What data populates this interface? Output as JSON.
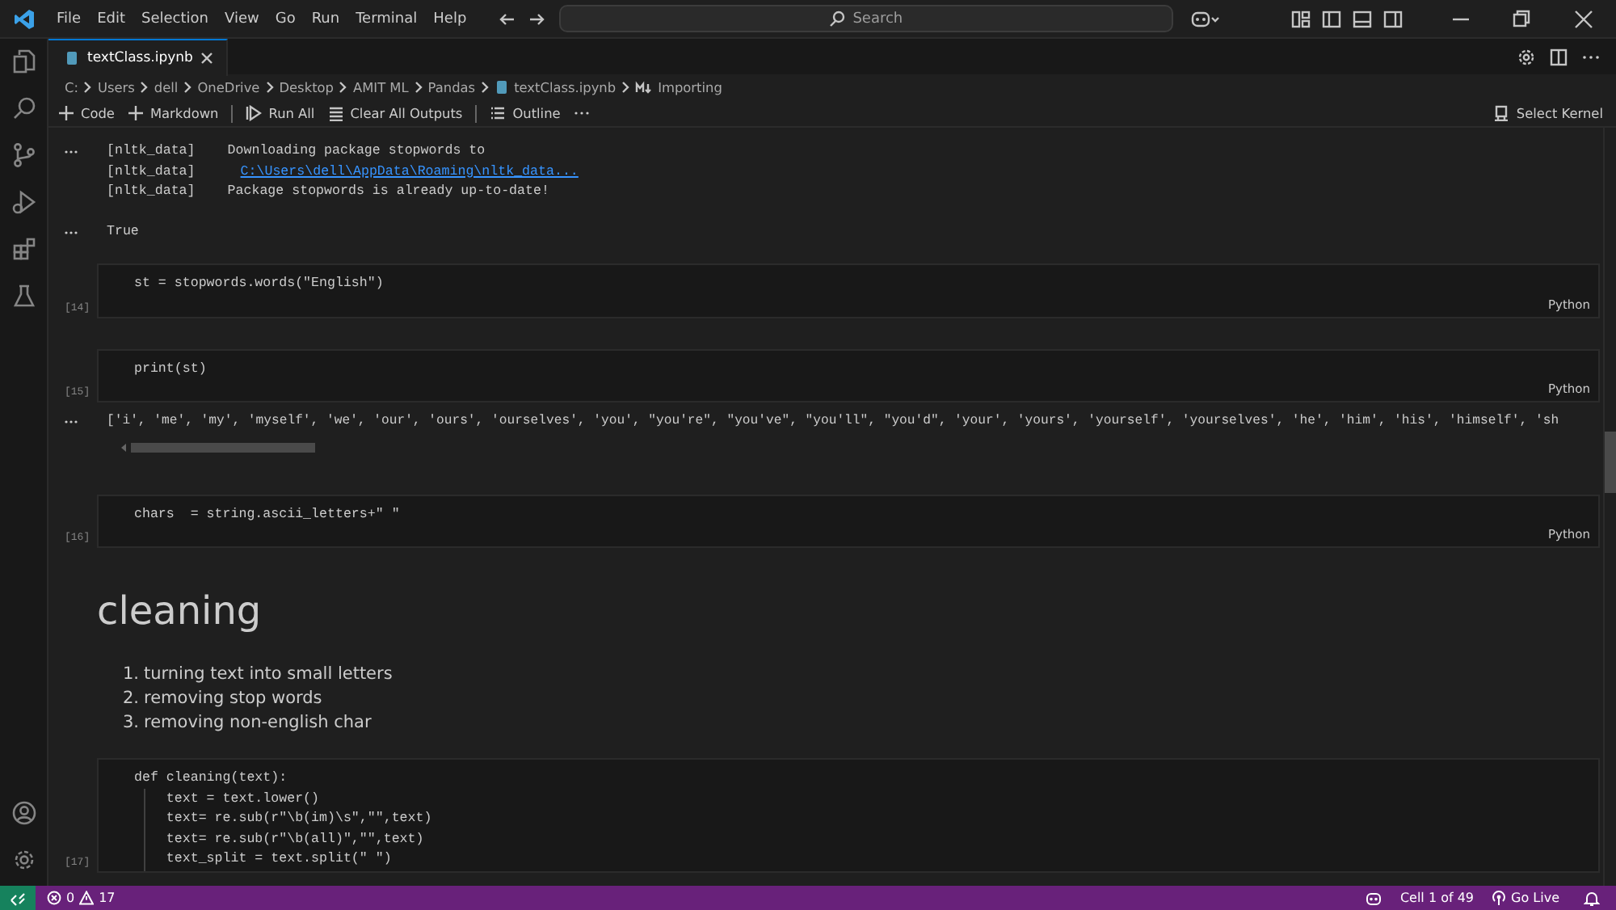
{
  "menu": [
    "File",
    "Edit",
    "Selection",
    "View",
    "Go",
    "Run",
    "Terminal",
    "Help"
  ],
  "search": {
    "placeholder": "Search"
  },
  "tabs": [
    {
      "label": "textClass.ipynb",
      "selected": true
    }
  ],
  "breadcrumb": [
    "C:",
    "Users",
    "dell",
    "OneDrive",
    "Desktop",
    "AMIT ML",
    "Pandas",
    "textClass.ipynb",
    "Importing"
  ],
  "toolbar": [
    {
      "kind": "plus",
      "label": "Code"
    },
    {
      "kind": "plus",
      "label": "Markdown"
    },
    {
      "kind": "run",
      "label": "Run All"
    },
    {
      "kind": "clear",
      "label": "Clear All Outputs"
    },
    {
      "kind": "outline",
      "label": "Outline"
    }
  ],
  "kernel": "Select Kernel",
  "cells": [
    {
      "kind": "output",
      "groups": [
        {
          "lines": [
            {
              "prefix": "[nltk_data]",
              "text": "Downloading package stopwords to",
              "kind": "text"
            },
            {
              "prefix": "[nltk_data]",
              "text": "C:\\Users\\dell\\AppData\\Roaming\\nltk_data...",
              "kind": "link"
            },
            {
              "prefix": "[nltk_data]",
              "text": "Package stopwords is already up-to-date!",
              "kind": "text"
            }
          ]
        },
        {
          "lines": [
            {
              "text": "True",
              "kind": "text"
            }
          ]
        }
      ]
    },
    {
      "kind": "code",
      "count": "[14]",
      "language": "Python",
      "lines": [
        "st = stopwords.words(\"English\")"
      ]
    },
    {
      "kind": "code",
      "count": "[15]",
      "language": "Python",
      "lines": [
        "print(st)"
      ],
      "output": "['i', 'me', 'my', 'myself', 'we', 'our', 'ours', 'ourselves', 'you', \"you're\", \"you've\", \"you'll\", \"you'd\", 'your', 'yours', 'yourself', 'yourselves', 'he', 'him', 'his', 'himself', 'sh"
    },
    {
      "kind": "code",
      "count": "[16]",
      "language": "Python",
      "lines": [
        "chars  = string.ascii_letters+\" \""
      ]
    },
    {
      "kind": "markdown",
      "heading": "cleaning",
      "items": [
        {
          "number": "1.",
          "text": "turning text into small letters"
        },
        {
          "number": "2.",
          "text": "removing stop words"
        },
        {
          "number": "3.",
          "text": "removing non-english char"
        }
      ]
    },
    {
      "kind": "code",
      "count": "[17]",
      "lines": [
        "def cleaning(text):",
        "    text = text.lower()",
        "    text= re.sub(r\"\\b(im)\\s\",\"\",text)",
        "    text= re.sub(r\"\\b(all)\",\"\",text)",
        "    text_split = text.split(\" \")"
      ]
    }
  ],
  "status": {
    "errors": "0",
    "warnings": "17",
    "cell": "Cell 1 of 49",
    "live": "Go Live"
  }
}
